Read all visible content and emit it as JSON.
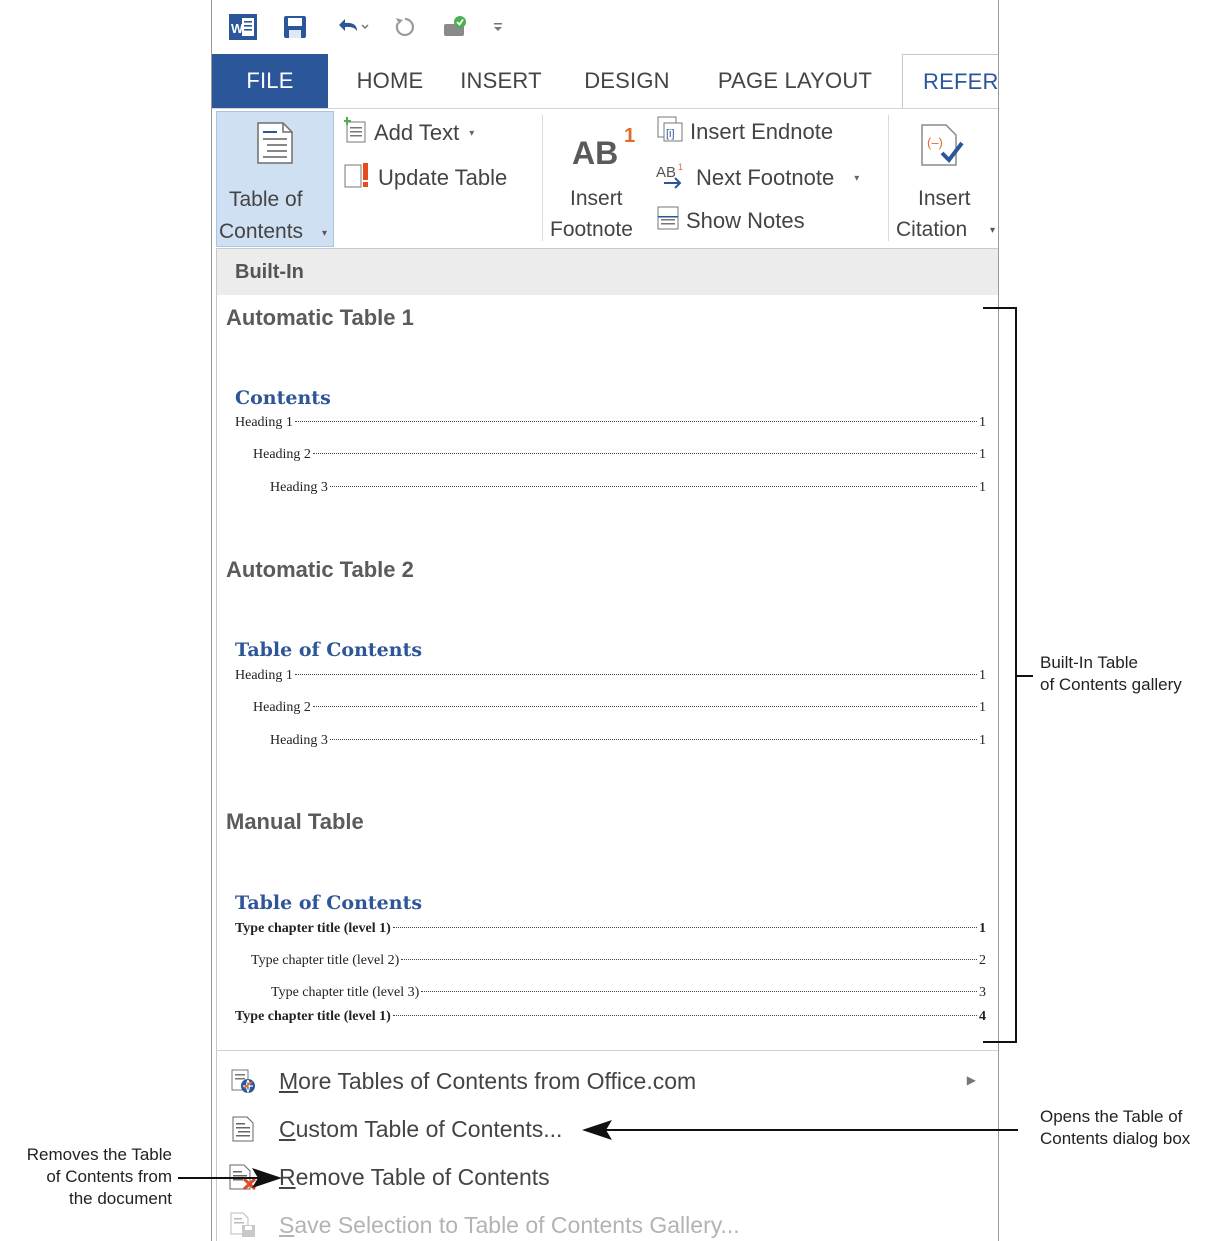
{
  "quick_access": {
    "app_icon": "word-app-icon",
    "save_icon": "save-icon",
    "undo_icon": "undo-icon",
    "redo_icon": "redo-icon",
    "touch_mode_icon": "touch-mode-icon",
    "customize_icon": "customize-qat-icon"
  },
  "tabs": {
    "file": "FILE",
    "home": "HOME",
    "insert": "INSERT",
    "design": "DESIGN",
    "page_layout": "PAGE LAYOUT",
    "references": "REFERE"
  },
  "ribbon": {
    "toc_line1": "Table of",
    "toc_line2": "Contents",
    "add_text": "Add Text",
    "update_table": "Update Table",
    "insert_footnote_line1": "Insert",
    "insert_footnote_line2": "Footnote",
    "footnote_glyph": "AB",
    "footnote_super": "1",
    "insert_endnote": "Insert Endnote",
    "next_footnote": "Next Footnote",
    "show_notes": "Show Notes",
    "insert_citation_line1": "Insert",
    "insert_citation_line2": "Citation"
  },
  "gallery": {
    "header": "Built-In",
    "automatic1": {
      "title": "Automatic Table 1",
      "toc_heading": "Contents",
      "rows": [
        {
          "text": "Heading 1",
          "page": "1"
        },
        {
          "text": "Heading 2",
          "page": "1"
        },
        {
          "text": "Heading 3",
          "page": "1"
        }
      ]
    },
    "automatic2": {
      "title": "Automatic Table 2",
      "toc_heading": "Table of Contents",
      "rows": [
        {
          "text": "Heading 1",
          "page": "1"
        },
        {
          "text": "Heading 2",
          "page": "1"
        },
        {
          "text": "Heading 3",
          "page": "1"
        }
      ]
    },
    "manual": {
      "title": "Manual Table",
      "toc_heading": "Table of Contents",
      "rows": [
        {
          "text": "Type chapter title (level 1)",
          "page": "1"
        },
        {
          "text": "Type chapter title (level 2)",
          "page": "2"
        },
        {
          "text": "Type chapter title (level 3)",
          "page": "3"
        },
        {
          "text": "Type chapter title (level 1)",
          "page": "4"
        }
      ]
    }
  },
  "menu": {
    "more_tables": {
      "accel": "M",
      "rest": "ore Tables of Contents from Office.com"
    },
    "custom_toc": {
      "accel": "C",
      "rest": "ustom Table of Contents..."
    },
    "remove_toc": {
      "accel": "R",
      "rest": "emove Table of Contents"
    },
    "save_selection": {
      "accel": "S",
      "rest": "ave Selection to Table of Contents Gallery..."
    }
  },
  "callouts": {
    "gallery_line1": "Built-In Table",
    "gallery_line2": "of Contents gallery",
    "dialog_line1": "Opens the Table of",
    "dialog_line2": "Contents dialog box",
    "remove_line1": "Removes the Table",
    "remove_line2": "of Contents from",
    "remove_line3": "the document"
  },
  "colors": {
    "file_tab": "#2b579a",
    "toc_heading": "#2e5597",
    "selected_button": "#cfe0f3"
  }
}
